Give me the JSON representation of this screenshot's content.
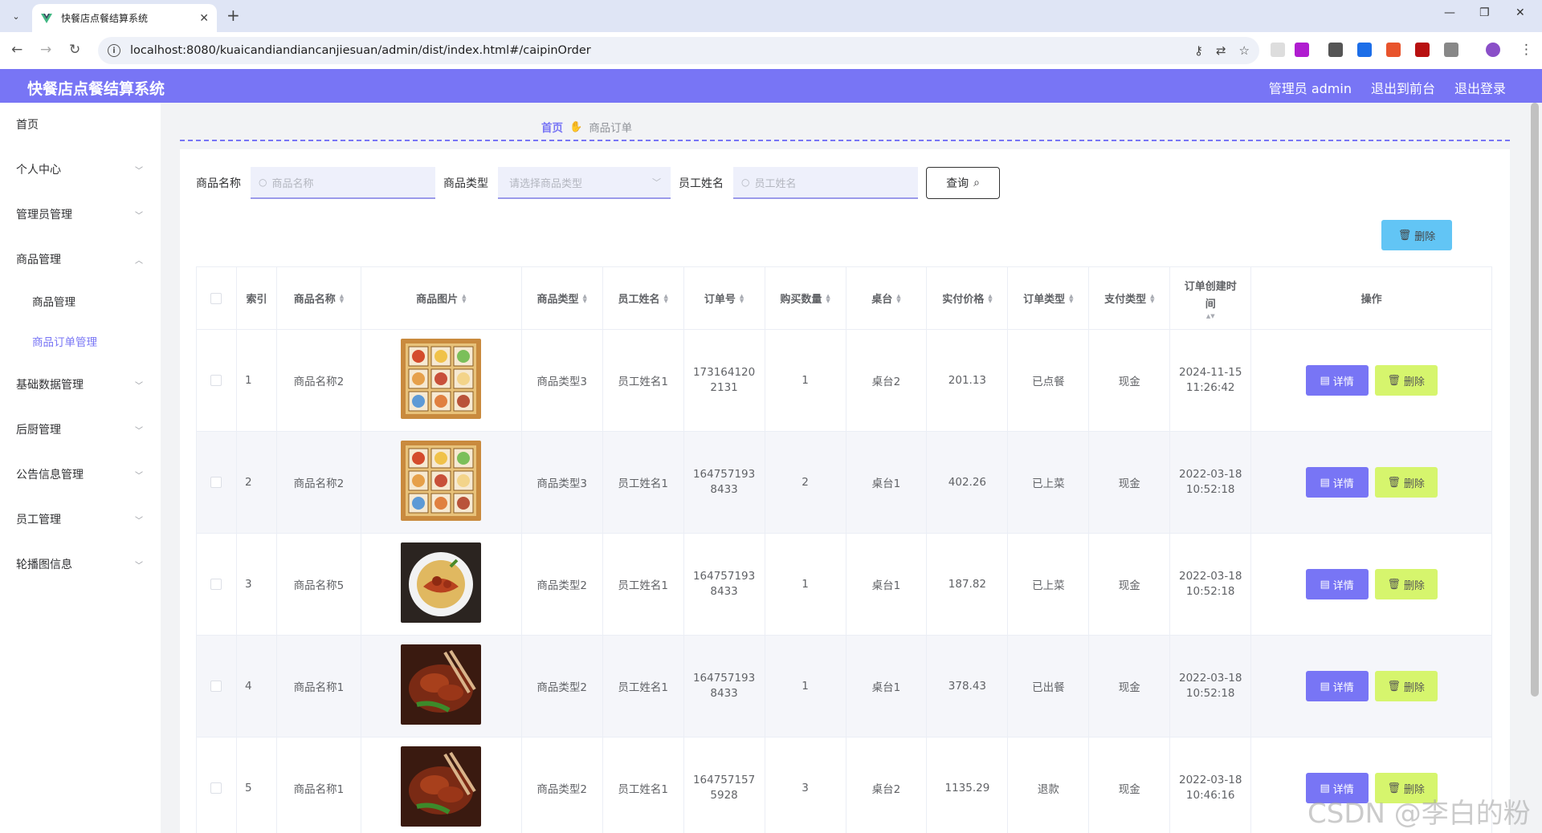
{
  "browser": {
    "tab_title": "快餐店点餐结算系统",
    "url": "localhost:8080/kuaicandiandiancanjiesuan/admin/dist/index.html#/caipinOrder"
  },
  "header": {
    "title": "快餐店点餐结算系统",
    "links": [
      "管理员 admin",
      "退出到前台",
      "退出登录"
    ]
  },
  "sidebar": {
    "items": [
      {
        "label": "首页"
      },
      {
        "label": "个人中心"
      },
      {
        "label": "管理员管理"
      },
      {
        "label": "商品管理"
      },
      {
        "label": "商品管理"
      },
      {
        "label": "商品订单管理"
      },
      {
        "label": "基础数据管理"
      },
      {
        "label": "后厨管理"
      },
      {
        "label": "公告信息管理"
      },
      {
        "label": "员工管理"
      },
      {
        "label": "轮播图信息"
      }
    ]
  },
  "breadcrumb": {
    "home": "首页",
    "current": "商品订单"
  },
  "search": {
    "name_label": "商品名称",
    "name_placeholder": "商品名称",
    "type_label": "商品类型",
    "type_placeholder": "请选择商品类型",
    "staff_label": "员工姓名",
    "staff_placeholder": "员工姓名",
    "query_label": "查询"
  },
  "toolbar": {
    "delete_label": "删除"
  },
  "table": {
    "headers": [
      "索引",
      "商品名称",
      "商品图片",
      "商品类型",
      "员工姓名",
      "订单号",
      "购买数量",
      "桌台",
      "实付价格",
      "订单类型",
      "支付类型",
      "订单创建时间",
      "操作"
    ],
    "rows": [
      {
        "index": "1",
        "name": "商品名称2",
        "type": "商品类型3",
        "staff": "员工姓名1",
        "order_no_a": "173164120",
        "order_no_b": "2131",
        "qty": "1",
        "table": "桌台2",
        "price": "201.13",
        "order_type": "已点餐",
        "pay_type": "现金",
        "date": "2024-11-15",
        "time": "11:26:42",
        "image": "dim-sum-box"
      },
      {
        "index": "2",
        "name": "商品名称2",
        "type": "商品类型3",
        "staff": "员工姓名1",
        "order_no_a": "164757193",
        "order_no_b": "8433",
        "qty": "2",
        "table": "桌台1",
        "price": "402.26",
        "order_type": "已上菜",
        "pay_type": "现金",
        "date": "2022-03-18",
        "time": "10:52:18",
        "image": "dim-sum-box"
      },
      {
        "index": "3",
        "name": "商品名称5",
        "type": "商品类型2",
        "staff": "员工姓名1",
        "order_no_a": "164757193",
        "order_no_b": "8433",
        "qty": "1",
        "table": "桌台1",
        "price": "187.82",
        "order_type": "已上菜",
        "pay_type": "现金",
        "date": "2022-03-18",
        "time": "10:52:18",
        "image": "spaghetti"
      },
      {
        "index": "4",
        "name": "商品名称1",
        "type": "商品类型2",
        "staff": "员工姓名1",
        "order_no_a": "164757193",
        "order_no_b": "8433",
        "qty": "1",
        "table": "桌台1",
        "price": "378.43",
        "order_type": "已出餐",
        "pay_type": "现金",
        "date": "2022-03-18",
        "time": "10:52:18",
        "image": "grilled-meat"
      },
      {
        "index": "5",
        "name": "商品名称1",
        "type": "商品类型2",
        "staff": "员工姓名1",
        "order_no_a": "164757157",
        "order_no_b": "5928",
        "qty": "3",
        "table": "桌台2",
        "price": "1135.29",
        "order_type": "退款",
        "pay_type": "现金",
        "date": "2022-03-18",
        "time": "10:46:16",
        "image": "grilled-meat"
      }
    ],
    "detail_label": "详情",
    "delete_label": "删除"
  },
  "watermark": "CSDN @李白的粉",
  "colors": {
    "accent": "#7875f5",
    "delete_top": "#62c5f5",
    "delete_row": "#d6f56d"
  }
}
